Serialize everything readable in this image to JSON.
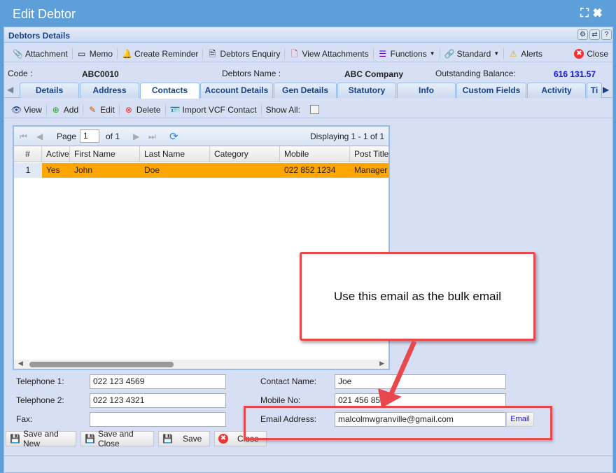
{
  "window": {
    "title": "Edit Debtor"
  },
  "panel": {
    "title": "Debtors Details"
  },
  "toolbar": [
    {
      "label": "Attachment",
      "icon": "paperclip-icon"
    },
    {
      "label": "Memo",
      "icon": "memo-icon"
    },
    {
      "label": "Create Reminder",
      "icon": "bell-icon"
    },
    {
      "label": "Debtors Enquiry",
      "icon": "document-icon"
    },
    {
      "label": "View Attachments",
      "icon": "attachments-icon"
    },
    {
      "label": "Functions",
      "icon": "menu-icon"
    },
    {
      "label": "Standard",
      "icon": "link-icon"
    },
    {
      "label": "Alerts",
      "icon": "warning-icon"
    },
    {
      "label": "Close",
      "icon": "close-icon"
    }
  ],
  "info": {
    "code_label": "Code :",
    "code": "ABC0010",
    "name_label": "Debtors Name :",
    "name": "ABC Company",
    "balance_label": "Outstanding Balance:",
    "balance": "616 131.57"
  },
  "tabs": [
    "Details",
    "Address",
    "Contacts",
    "Account Details",
    "Gen Details",
    "Statutory",
    "Info",
    "Custom Fields",
    "Activity",
    "Ti"
  ],
  "active_tab": "Contacts",
  "subtoolbar": {
    "view": "View",
    "add": "Add",
    "edit": "Edit",
    "delete": "Delete",
    "import": "Import VCF Contact",
    "show_all": "Show All:"
  },
  "pager": {
    "page_label": "Page",
    "page": "1",
    "of": "of 1",
    "displaying": "Displaying 1 - 1 of 1"
  },
  "grid": {
    "columns": [
      "#",
      "Active",
      "First Name",
      "Last Name",
      "Category",
      "Mobile",
      "Post Title"
    ],
    "rows": [
      [
        "1",
        "Yes",
        "John",
        "Doe",
        "",
        "022 852 1234",
        "Manager"
      ]
    ]
  },
  "form": {
    "tel1_label": "Telephone 1:",
    "tel1": "022 123 4569",
    "tel2_label": "Telephone 2:",
    "tel2": "022 123 4321",
    "fax_label": "Fax:",
    "fax": "",
    "contact_label": "Contact Name:",
    "contact": "Joe",
    "mobile_label": "Mobile No:",
    "mobile": "021 456 852",
    "email_label": "Email Address:",
    "email": "malcolmwgranville@gmail.com",
    "email_button": "Email"
  },
  "buttons": {
    "save_new": "Save and New",
    "save_close": "Save and Close",
    "save": "Save",
    "close": "Close"
  },
  "callout": {
    "text": "Use this email as the bulk email"
  }
}
